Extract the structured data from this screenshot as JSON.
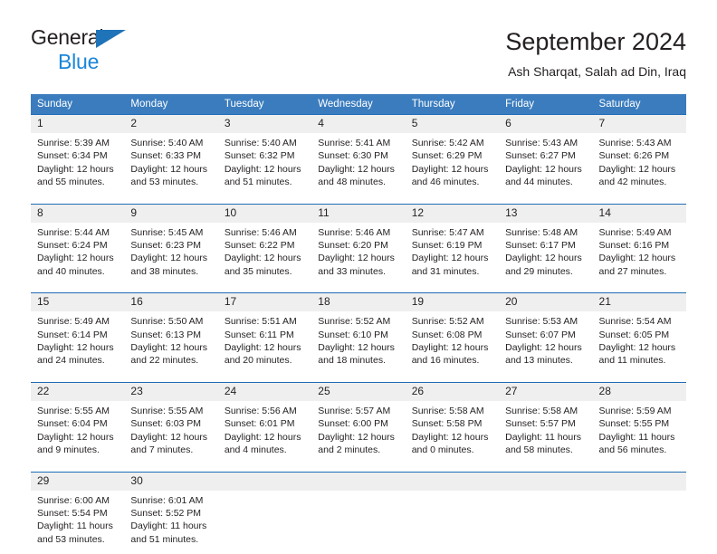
{
  "logo": {
    "line1": "General",
    "line2": "Blue",
    "flag_icon": "blue-triangle-flag-icon"
  },
  "header": {
    "title": "September 2024",
    "subtitle": "Ash Sharqat, Salah ad Din, Iraq"
  },
  "colors": {
    "header_blue": "#3a7cbe",
    "row_rule_blue": "#1f6db5",
    "daynum_band": "#efefef",
    "logo_blue": "#1a86d9",
    "text": "#231f20"
  },
  "weekday_headers": [
    "Sunday",
    "Monday",
    "Tuesday",
    "Wednesday",
    "Thursday",
    "Friday",
    "Saturday"
  ],
  "weeks": [
    [
      {
        "day": "1",
        "sunrise": "Sunrise: 5:39 AM",
        "sunset": "Sunset: 6:34 PM",
        "daylight1": "Daylight: 12 hours",
        "daylight2": "and 55 minutes."
      },
      {
        "day": "2",
        "sunrise": "Sunrise: 5:40 AM",
        "sunset": "Sunset: 6:33 PM",
        "daylight1": "Daylight: 12 hours",
        "daylight2": "and 53 minutes."
      },
      {
        "day": "3",
        "sunrise": "Sunrise: 5:40 AM",
        "sunset": "Sunset: 6:32 PM",
        "daylight1": "Daylight: 12 hours",
        "daylight2": "and 51 minutes."
      },
      {
        "day": "4",
        "sunrise": "Sunrise: 5:41 AM",
        "sunset": "Sunset: 6:30 PM",
        "daylight1": "Daylight: 12 hours",
        "daylight2": "and 48 minutes."
      },
      {
        "day": "5",
        "sunrise": "Sunrise: 5:42 AM",
        "sunset": "Sunset: 6:29 PM",
        "daylight1": "Daylight: 12 hours",
        "daylight2": "and 46 minutes."
      },
      {
        "day": "6",
        "sunrise": "Sunrise: 5:43 AM",
        "sunset": "Sunset: 6:27 PM",
        "daylight1": "Daylight: 12 hours",
        "daylight2": "and 44 minutes."
      },
      {
        "day": "7",
        "sunrise": "Sunrise: 5:43 AM",
        "sunset": "Sunset: 6:26 PM",
        "daylight1": "Daylight: 12 hours",
        "daylight2": "and 42 minutes."
      }
    ],
    [
      {
        "day": "8",
        "sunrise": "Sunrise: 5:44 AM",
        "sunset": "Sunset: 6:24 PM",
        "daylight1": "Daylight: 12 hours",
        "daylight2": "and 40 minutes."
      },
      {
        "day": "9",
        "sunrise": "Sunrise: 5:45 AM",
        "sunset": "Sunset: 6:23 PM",
        "daylight1": "Daylight: 12 hours",
        "daylight2": "and 38 minutes."
      },
      {
        "day": "10",
        "sunrise": "Sunrise: 5:46 AM",
        "sunset": "Sunset: 6:22 PM",
        "daylight1": "Daylight: 12 hours",
        "daylight2": "and 35 minutes."
      },
      {
        "day": "11",
        "sunrise": "Sunrise: 5:46 AM",
        "sunset": "Sunset: 6:20 PM",
        "daylight1": "Daylight: 12 hours",
        "daylight2": "and 33 minutes."
      },
      {
        "day": "12",
        "sunrise": "Sunrise: 5:47 AM",
        "sunset": "Sunset: 6:19 PM",
        "daylight1": "Daylight: 12 hours",
        "daylight2": "and 31 minutes."
      },
      {
        "day": "13",
        "sunrise": "Sunrise: 5:48 AM",
        "sunset": "Sunset: 6:17 PM",
        "daylight1": "Daylight: 12 hours",
        "daylight2": "and 29 minutes."
      },
      {
        "day": "14",
        "sunrise": "Sunrise: 5:49 AM",
        "sunset": "Sunset: 6:16 PM",
        "daylight1": "Daylight: 12 hours",
        "daylight2": "and 27 minutes."
      }
    ],
    [
      {
        "day": "15",
        "sunrise": "Sunrise: 5:49 AM",
        "sunset": "Sunset: 6:14 PM",
        "daylight1": "Daylight: 12 hours",
        "daylight2": "and 24 minutes."
      },
      {
        "day": "16",
        "sunrise": "Sunrise: 5:50 AM",
        "sunset": "Sunset: 6:13 PM",
        "daylight1": "Daylight: 12 hours",
        "daylight2": "and 22 minutes."
      },
      {
        "day": "17",
        "sunrise": "Sunrise: 5:51 AM",
        "sunset": "Sunset: 6:11 PM",
        "daylight1": "Daylight: 12 hours",
        "daylight2": "and 20 minutes."
      },
      {
        "day": "18",
        "sunrise": "Sunrise: 5:52 AM",
        "sunset": "Sunset: 6:10 PM",
        "daylight1": "Daylight: 12 hours",
        "daylight2": "and 18 minutes."
      },
      {
        "day": "19",
        "sunrise": "Sunrise: 5:52 AM",
        "sunset": "Sunset: 6:08 PM",
        "daylight1": "Daylight: 12 hours",
        "daylight2": "and 16 minutes."
      },
      {
        "day": "20",
        "sunrise": "Sunrise: 5:53 AM",
        "sunset": "Sunset: 6:07 PM",
        "daylight1": "Daylight: 12 hours",
        "daylight2": "and 13 minutes."
      },
      {
        "day": "21",
        "sunrise": "Sunrise: 5:54 AM",
        "sunset": "Sunset: 6:05 PM",
        "daylight1": "Daylight: 12 hours",
        "daylight2": "and 11 minutes."
      }
    ],
    [
      {
        "day": "22",
        "sunrise": "Sunrise: 5:55 AM",
        "sunset": "Sunset: 6:04 PM",
        "daylight1": "Daylight: 12 hours",
        "daylight2": "and 9 minutes."
      },
      {
        "day": "23",
        "sunrise": "Sunrise: 5:55 AM",
        "sunset": "Sunset: 6:03 PM",
        "daylight1": "Daylight: 12 hours",
        "daylight2": "and 7 minutes."
      },
      {
        "day": "24",
        "sunrise": "Sunrise: 5:56 AM",
        "sunset": "Sunset: 6:01 PM",
        "daylight1": "Daylight: 12 hours",
        "daylight2": "and 4 minutes."
      },
      {
        "day": "25",
        "sunrise": "Sunrise: 5:57 AM",
        "sunset": "Sunset: 6:00 PM",
        "daylight1": "Daylight: 12 hours",
        "daylight2": "and 2 minutes."
      },
      {
        "day": "26",
        "sunrise": "Sunrise: 5:58 AM",
        "sunset": "Sunset: 5:58 PM",
        "daylight1": "Daylight: 12 hours",
        "daylight2": "and 0 minutes."
      },
      {
        "day": "27",
        "sunrise": "Sunrise: 5:58 AM",
        "sunset": "Sunset: 5:57 PM",
        "daylight1": "Daylight: 11 hours",
        "daylight2": "and 58 minutes."
      },
      {
        "day": "28",
        "sunrise": "Sunrise: 5:59 AM",
        "sunset": "Sunset: 5:55 PM",
        "daylight1": "Daylight: 11 hours",
        "daylight2": "and 56 minutes."
      }
    ],
    [
      {
        "day": "29",
        "sunrise": "Sunrise: 6:00 AM",
        "sunset": "Sunset: 5:54 PM",
        "daylight1": "Daylight: 11 hours",
        "daylight2": "and 53 minutes."
      },
      {
        "day": "30",
        "sunrise": "Sunrise: 6:01 AM",
        "sunset": "Sunset: 5:52 PM",
        "daylight1": "Daylight: 11 hours",
        "daylight2": "and 51 minutes."
      },
      {
        "day": "",
        "sunrise": "",
        "sunset": "",
        "daylight1": "",
        "daylight2": ""
      },
      {
        "day": "",
        "sunrise": "",
        "sunset": "",
        "daylight1": "",
        "daylight2": ""
      },
      {
        "day": "",
        "sunrise": "",
        "sunset": "",
        "daylight1": "",
        "daylight2": ""
      },
      {
        "day": "",
        "sunrise": "",
        "sunset": "",
        "daylight1": "",
        "daylight2": ""
      },
      {
        "day": "",
        "sunrise": "",
        "sunset": "",
        "daylight1": "",
        "daylight2": ""
      }
    ]
  ]
}
